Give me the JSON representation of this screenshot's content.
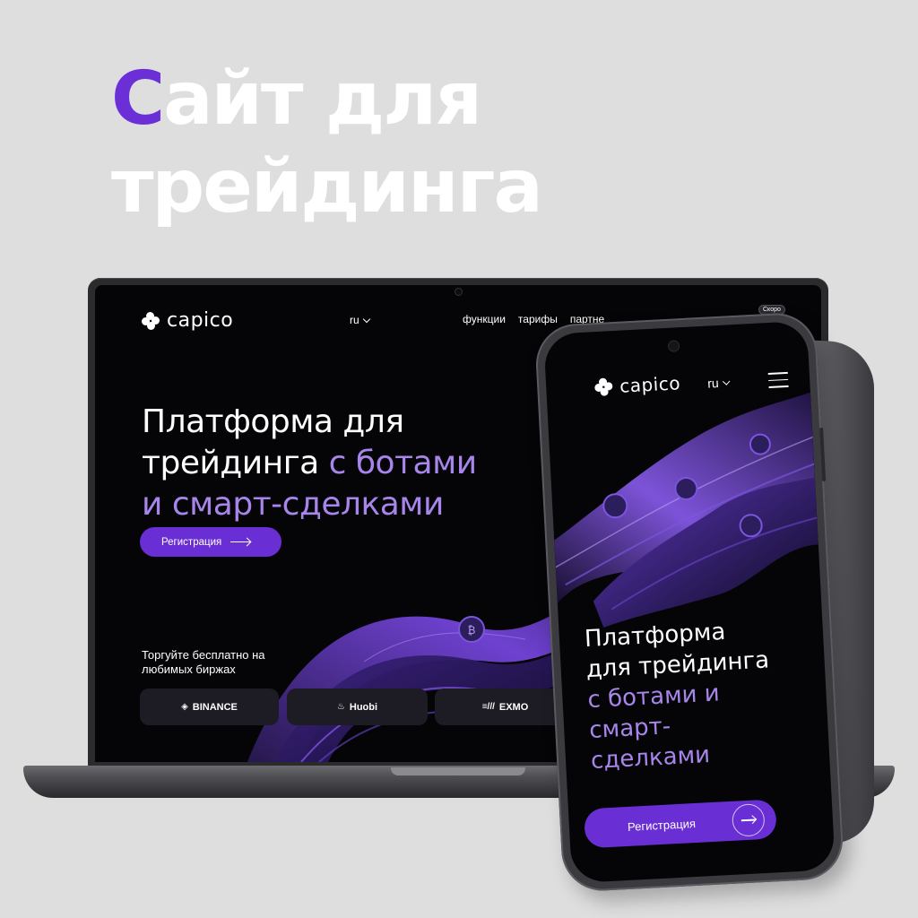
{
  "headline": {
    "accent": "С",
    "line1_rest": "айт для",
    "line2": "трейдинга"
  },
  "brand": {
    "name": "capico",
    "accent_color": "#6b2fd8",
    "button_color": "#6a2fd4",
    "highlight_color": "#a785ea"
  },
  "laptop": {
    "lang": "ru",
    "nav": [
      "функции",
      "тарифы",
      "партне"
    ],
    "soon_badge": "Скоро",
    "hero": {
      "line1": "Платформа для",
      "line2_a": "трейдинга ",
      "line2_b": "с ботами",
      "line3": "и смарт-сделками"
    },
    "cta": "Регистрация",
    "trade_text": "Торгуйте бесплатно на любимых биржах",
    "exchanges": [
      {
        "name": "BINANCE",
        "icon": "binance-icon"
      },
      {
        "name": "Huobi",
        "icon": "huobi-icon"
      },
      {
        "name": "EXMO",
        "icon": "exmo-icon"
      }
    ]
  },
  "phone": {
    "lang": "ru",
    "hero": {
      "line1": "Платформа",
      "line2": "для трейдинга",
      "line3": "с ботами и",
      "line4": "смарт-",
      "line5": "сделками"
    },
    "cta": "Регистрация"
  }
}
